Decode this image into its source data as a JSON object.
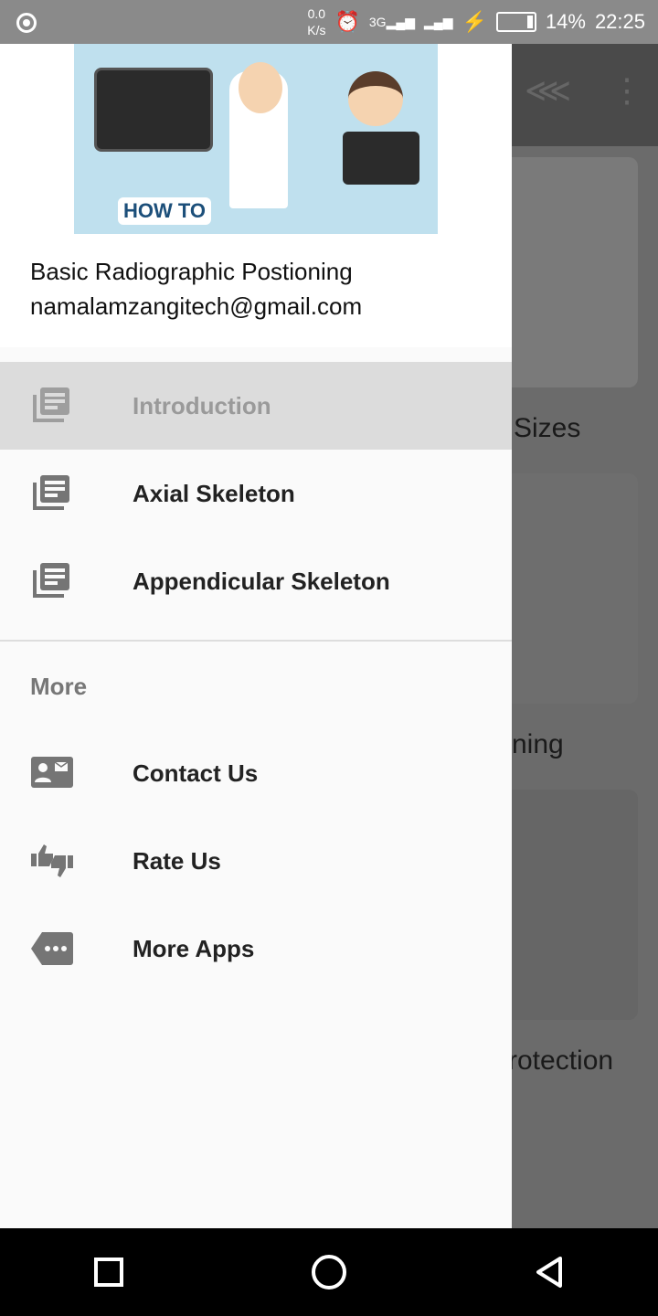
{
  "status": {
    "speed_value": "0.0",
    "speed_unit": "K/s",
    "network": "3G",
    "battery": "14%",
    "time": "22:25"
  },
  "background": {
    "labels": [
      "Sizes",
      "ning",
      "rotection"
    ]
  },
  "drawer": {
    "header": {
      "app_name": "Basic Radiographic Postioning",
      "email": "namalamzangitech@gmail.com",
      "banner_text": "HOW TO"
    },
    "items": [
      {
        "label": "Introduction",
        "icon": "library-books-icon",
        "selected": true
      },
      {
        "label": "Axial Skeleton",
        "icon": "library-books-icon"
      },
      {
        "label": "Appendicular Skeleton",
        "icon": "library-books-icon"
      }
    ],
    "section_title": "More",
    "more_items": [
      {
        "label": "Contact Us",
        "icon": "contact-mail-icon"
      },
      {
        "label": "Rate Us",
        "icon": "thumbs-up-down-icon"
      },
      {
        "label": "More Apps",
        "icon": "more-tag-icon"
      }
    ]
  },
  "colors": {
    "selected_bg": "#dcdcdc",
    "icon": "#757575"
  }
}
